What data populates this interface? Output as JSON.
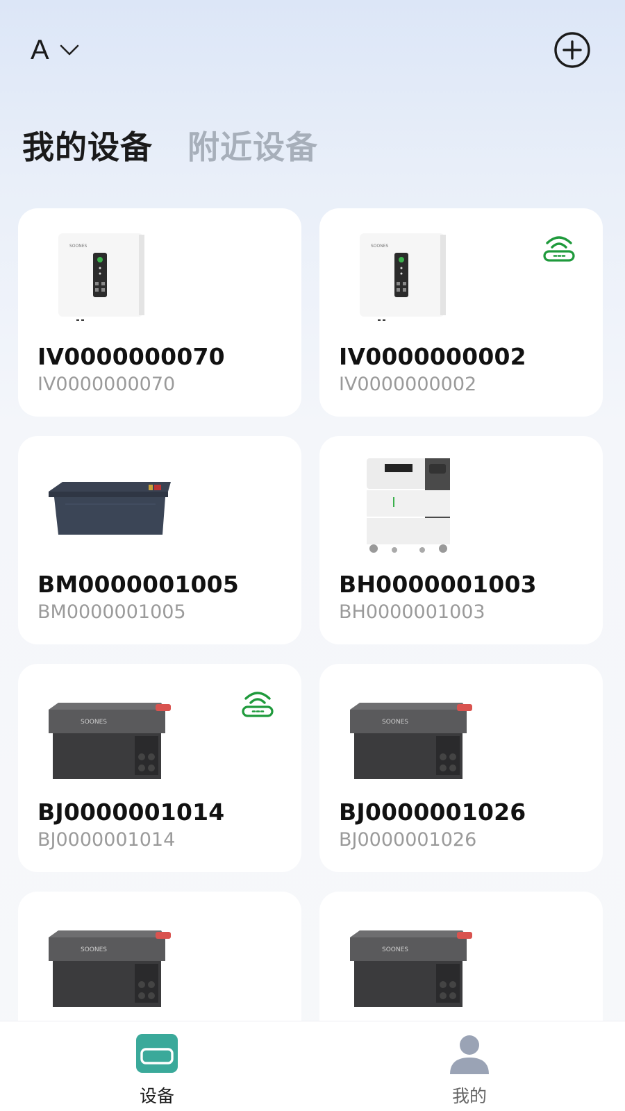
{
  "header": {
    "home_name": "A",
    "chevron_icon": "chevron-down-icon",
    "add_icon": "add-circle-icon"
  },
  "tabs": [
    {
      "label": "我的设备",
      "active": true
    },
    {
      "label": "附近设备",
      "active": false
    }
  ],
  "devices": [
    {
      "name": "IV0000000070",
      "serial": "IV0000000070",
      "image": "inverter-icon",
      "online": false
    },
    {
      "name": "IV0000000002",
      "serial": "IV0000000002",
      "image": "inverter-icon",
      "online": true
    },
    {
      "name": "BM0000001005",
      "serial": "BM0000001005",
      "image": "battery-module-icon",
      "online": false
    },
    {
      "name": "BH0000001003",
      "serial": "BH0000001003",
      "image": "home-battery-stack-icon",
      "online": false
    },
    {
      "name": "BJ0000001014",
      "serial": "BJ0000001014",
      "image": "portable-power-station-icon",
      "online": true
    },
    {
      "name": "BJ0000001026",
      "serial": "BJ0000001026",
      "image": "portable-power-station-icon",
      "online": false
    },
    {
      "name": "",
      "serial": "",
      "image": "portable-power-station-icon",
      "online": false
    },
    {
      "name": "",
      "serial": "",
      "image": "portable-power-station-icon",
      "online": false
    }
  ],
  "colors": {
    "online_green": "#1f9a3c",
    "nav_active": "#3aa99a",
    "nav_inactive": "#9aa3b5",
    "tab_inactive": "#a7afba"
  },
  "bottom_nav": [
    {
      "label": "设备",
      "icon": "devices-icon",
      "active": true
    },
    {
      "label": "我的",
      "icon": "profile-icon",
      "active": false
    }
  ]
}
